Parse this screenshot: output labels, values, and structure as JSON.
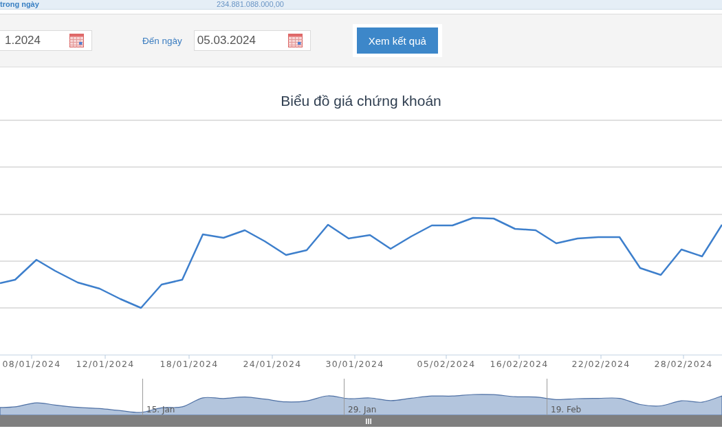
{
  "summary_row": {
    "label": "trong ngày",
    "value": "234.881.088.000,00"
  },
  "filter": {
    "fields": [
      {
        "value": "1.2024"
      },
      {
        "label": "Đến ngày",
        "value": "05.03.2024"
      }
    ],
    "button": {
      "label": "Xem kết quả"
    }
  },
  "chart": {
    "title": "Biểu đồ giá chứng khoán",
    "x_axis_labels": [
      "08/01/2024",
      "12/01/2024",
      "18/01/2024",
      "24/01/2024",
      "30/01/2024",
      "05/02/2024",
      "16/02/2024",
      "22/02/2024",
      "28/02/2024"
    ],
    "navigator_labels": [
      "15. Jan",
      "29. Jan",
      "19. Feb"
    ]
  }
}
